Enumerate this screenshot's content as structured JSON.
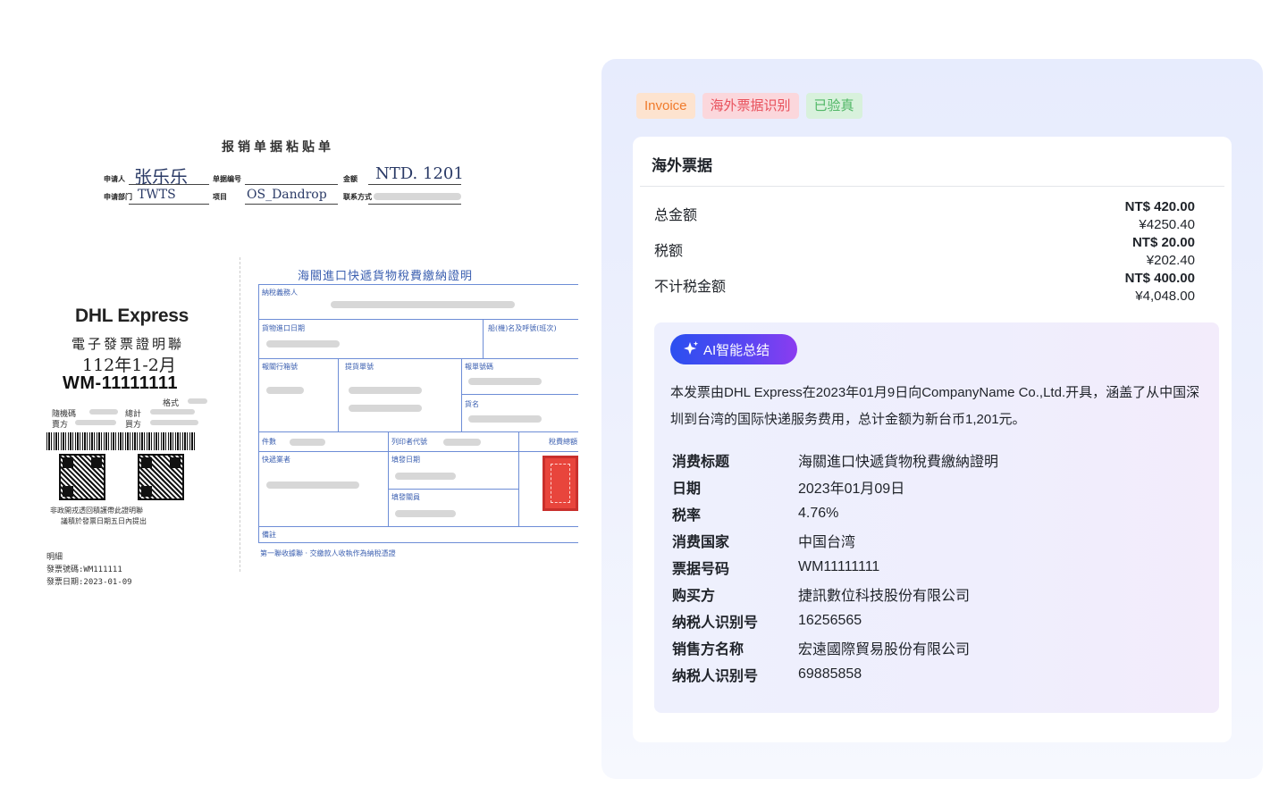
{
  "scan": {
    "title": "报销单据粘贴单",
    "applicant_label": "申请人",
    "applicant": "张乐乐",
    "doc_no_label": "单据编号",
    "amount_label": "金额",
    "amount": "NTD. 1201",
    "dept_label": "申请部门",
    "dept": "TWTS",
    "project_label": "项目",
    "project": "OS_Dandrop",
    "contact_label": "联系方式",
    "receipt": {
      "brand": "DHL Express",
      "doc_type": "電子發票證明聯",
      "period": "112年1-2月",
      "number": "WM-11111111",
      "format_label": "格式",
      "random_label": "隨機碼",
      "total_label": "總計",
      "seller_label": "賣方",
      "buyer_label": "買方",
      "note1": "非政開戎透回積護帶此證明聯",
      "note2": "議積於發票日期五日內提出",
      "detail_label": "明細",
      "invoice_no_line": "發票號碼:WM111111",
      "invoice_date_line": "發票日期:2023-01-09"
    },
    "customs": {
      "title": "海關進口快遞貨物稅費繳納證明",
      "f_taxpayer": "納稅義務人",
      "f_import_date": "貨物進口日期",
      "f_vessel": "船(機)名及呼號(班次)",
      "f_customs_box": "報關行箱號",
      "f_bill": "提貨單號",
      "f_declaration": "報單號碼",
      "f_goods": "貨名",
      "f_pieces": "件數",
      "f_printer": "列印者代號",
      "f_tax_amount": "稅費總額",
      "f_courier": "快遞業者",
      "f_issue_date": "填發日期",
      "f_issuer": "填發關員",
      "f_remarks": "備註",
      "footer": "第一聯收據聯 · 交繳款人收執作為納稅憑證"
    }
  },
  "panel": {
    "tags": [
      "Invoice",
      "海外票据识别",
      "已验真"
    ],
    "card_title": "海外票据",
    "amounts": [
      {
        "label": "总金额",
        "main": "NT$ 420.00",
        "sub": "¥4250.40"
      },
      {
        "label": "税额",
        "main": "NT$ 20.00",
        "sub": "¥202.40"
      },
      {
        "label": "不计税金额",
        "main": "NT$ 400.00",
        "sub": "¥4,048.00"
      }
    ],
    "ai": {
      "label": "AI智能总结",
      "summary": "本发票由DHL Express在2023年01月9日向CompanyName Co.,Ltd.开具，涵盖了从中国深圳到台湾的国际快递服务费用，总计金额为新台币1,201元。"
    },
    "fields": [
      {
        "key": "消费标题",
        "value": "海關進口快遞貨物稅費繳納證明"
      },
      {
        "key": "日期",
        "value": "2023年01月09日"
      },
      {
        "key": "税率",
        "value": "4.76%"
      },
      {
        "key": "消费国家",
        "value": "中国台湾"
      },
      {
        "key": "票据号码",
        "value": "WM11111111"
      },
      {
        "key": "购买方",
        "value": "捷訊數位科技股份有限公司"
      },
      {
        "key": "纳税人识别号",
        "value": "16256565"
      },
      {
        "key": "销售方名称",
        "value": "宏遠國際貿易股份有限公司"
      },
      {
        "key": "纳税人识别号",
        "value": "69885858"
      }
    ]
  },
  "colors": {
    "accent": "#2b4ff0",
    "tag_invoice": "#f07a2a",
    "tag_overseas": "#e8505b",
    "tag_verified": "#4fb665"
  }
}
